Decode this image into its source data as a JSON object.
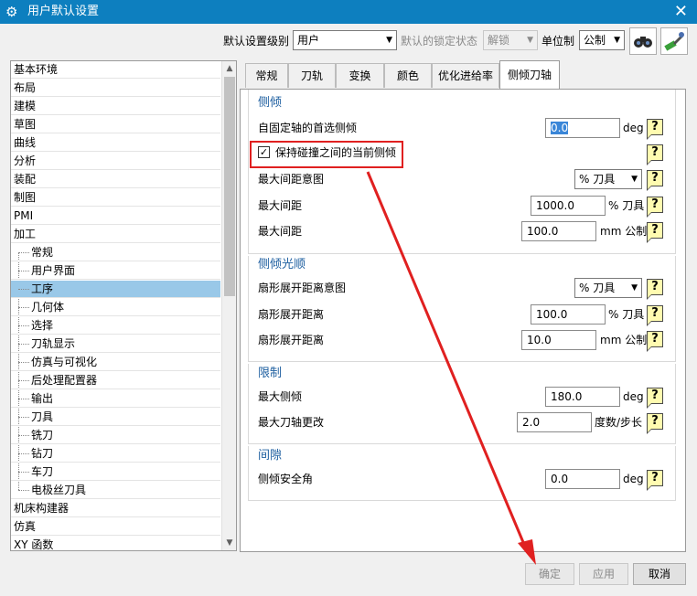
{
  "window": {
    "title": "用户默认设置",
    "close_glyph": "✕",
    "icon": "gear-icon"
  },
  "topbar": {
    "level_label": "默认设置级别",
    "level_value": "用户",
    "lock_label": "默认的锁定状态",
    "lock_value": "解锁",
    "unit_label": "单位制",
    "unit_value": "公制",
    "icons": [
      "binoculars-icon",
      "wrench-icon"
    ]
  },
  "tree": {
    "items": [
      {
        "label": "基本环境",
        "level": 0
      },
      {
        "label": "布局",
        "level": 0
      },
      {
        "label": "建模",
        "level": 0
      },
      {
        "label": "草图",
        "level": 0
      },
      {
        "label": "曲线",
        "level": 0
      },
      {
        "label": "分析",
        "level": 0
      },
      {
        "label": "装配",
        "level": 0
      },
      {
        "label": "制图",
        "level": 0
      },
      {
        "label": "PMI",
        "level": 0
      },
      {
        "label": "加工",
        "level": 0
      },
      {
        "label": "常规",
        "level": 1
      },
      {
        "label": "用户界面",
        "level": 1
      },
      {
        "label": "工序",
        "level": 1,
        "selected": true
      },
      {
        "label": "几何体",
        "level": 1
      },
      {
        "label": "选择",
        "level": 1
      },
      {
        "label": "刀轨显示",
        "level": 1
      },
      {
        "label": "仿真与可视化",
        "level": 1
      },
      {
        "label": "后处理配置器",
        "level": 1
      },
      {
        "label": "输出",
        "level": 1
      },
      {
        "label": "刀具",
        "level": 1
      },
      {
        "label": "铣刀",
        "level": 1
      },
      {
        "label": "钻刀",
        "level": 1
      },
      {
        "label": "车刀",
        "level": 1
      },
      {
        "label": "电极丝刀具",
        "level": 1
      },
      {
        "label": "机床构建器",
        "level": 0
      },
      {
        "label": "仿真",
        "level": 0
      },
      {
        "label": "XY 函数",
        "level": 0
      }
    ]
  },
  "tabs": [
    {
      "label": "常规"
    },
    {
      "label": "刀轨"
    },
    {
      "label": "变换"
    },
    {
      "label": "颜色"
    },
    {
      "label": "优化进给率"
    },
    {
      "label": "侧倾刀轴",
      "active": true
    }
  ],
  "groups": {
    "tilt": {
      "title": "侧倾",
      "preferred_label": "自固定轴的首选侧倾",
      "preferred_value": "0.0",
      "preferred_unit": "deg",
      "keep_label": "保持碰撞之间的当前侧倾",
      "keep_checked": true,
      "max_gap_intent_label": "最大间距意图",
      "max_gap_intent_value": "% 刀具",
      "max_gap1_label": "最大间距",
      "max_gap1_value": "1000.0",
      "max_gap1_unit": "% 刀具",
      "max_gap2_label": "最大间距",
      "max_gap2_value": "100.0",
      "max_gap2_unit": "mm 公制"
    },
    "smooth": {
      "title": "侧倾光顺",
      "fan_intent_label": "扇形展开距离意图",
      "fan_intent_value": "% 刀具",
      "fan1_label": "扇形展开距离",
      "fan1_value": "100.0",
      "fan1_unit": "% 刀具",
      "fan2_label": "扇形展开距离",
      "fan2_value": "10.0",
      "fan2_unit": "mm 公制"
    },
    "limit": {
      "title": "限制",
      "max_tilt_label": "最大侧倾",
      "max_tilt_value": "180.0",
      "max_tilt_unit": "deg",
      "max_change_label": "最大刀轴更改",
      "max_change_value": "2.0",
      "max_change_unit": "度数/步长"
    },
    "clearance": {
      "title": "间隙",
      "safe_label": "侧倾安全角",
      "safe_value": "0.0",
      "safe_unit": "deg"
    }
  },
  "help_glyph": "?",
  "checkbox_glyph": "✓",
  "buttons": {
    "ok": "确定",
    "apply": "应用",
    "cancel": "取消"
  },
  "annotation_color": "#e02020",
  "accent_color": "#0d7fbf"
}
